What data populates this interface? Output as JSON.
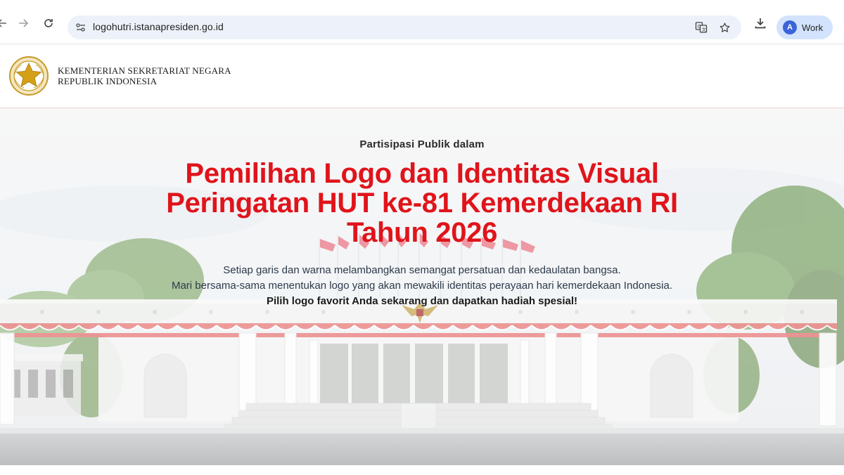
{
  "browser": {
    "url": "logohutri.istanapresiden.go.id",
    "profile_initial": "A",
    "profile_label": "Work"
  },
  "header": {
    "org_line1": "KEMENTERIAN SEKRETARIAT NEGARA",
    "org_line2": "REPUBLIK INDONESIA"
  },
  "hero": {
    "eyebrow": "Partisipasi Publik dalam",
    "title_line1": "Pemilihan Logo dan Identitas Visual",
    "title_line2": "Peringatan HUT ke-81 Kemerdekaan RI",
    "title_line3": "Tahun 2026",
    "desc_line1": "Setiap garis dan warna melambangkan semangat persatuan dan kedaulatan bangsa.",
    "desc_line2": "Mari bersama-sama menentukan logo yang akan mewakili identitas perayaan hari kemerdekaan Indonesia.",
    "desc_line3": "Pilih logo favorit Anda sekarang dan dapatkan hadiah spesial!"
  },
  "colors": {
    "title_red": "#e0141b",
    "chip_blue": "#d3e3fd",
    "omnibox": "#edf2fa"
  }
}
